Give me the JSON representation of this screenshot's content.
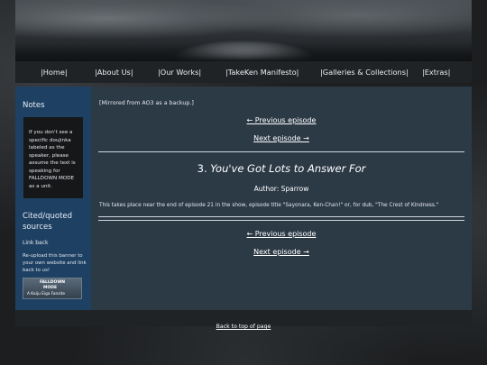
{
  "nav": {
    "items": [
      "|Home|",
      "|About Us|",
      "|Our Works|",
      "|TakeKen Manifesto|",
      "|Galleries & Collections|",
      "|Extras|"
    ]
  },
  "sidebar": {
    "notes_title": "Notes",
    "notes_text": "If you don't see a specific doujinka labeled as the speaker, please assume the text is speaking for FALLDOWN MODE as a unit.",
    "cited_title": "Cited/quoted sources",
    "link_back": "Link back",
    "reupload_text": "Re-upload this banner to your own website and link back to us!",
    "badge": {
      "line1": "FALLDOWN",
      "line2": "MODE",
      "line3": "A Kaiju Eiga Fansite"
    }
  },
  "content": {
    "mirrored": "[Mirrored from AO3 as a backup.]",
    "prev_episode": "← Previous episode",
    "next_episode": "Next episode →",
    "title_number": "3.",
    "title_text": "You've Got Lots to Answer For",
    "author": "Author: Sparrow",
    "summary": "This takes place near the end of episode 21 in the show, episode title \"Sayonara, Ken-Chan!\" or, for dub, \"The Crest of Kindness.\""
  },
  "footer": {
    "back_to_top": "Back to top of page"
  }
}
